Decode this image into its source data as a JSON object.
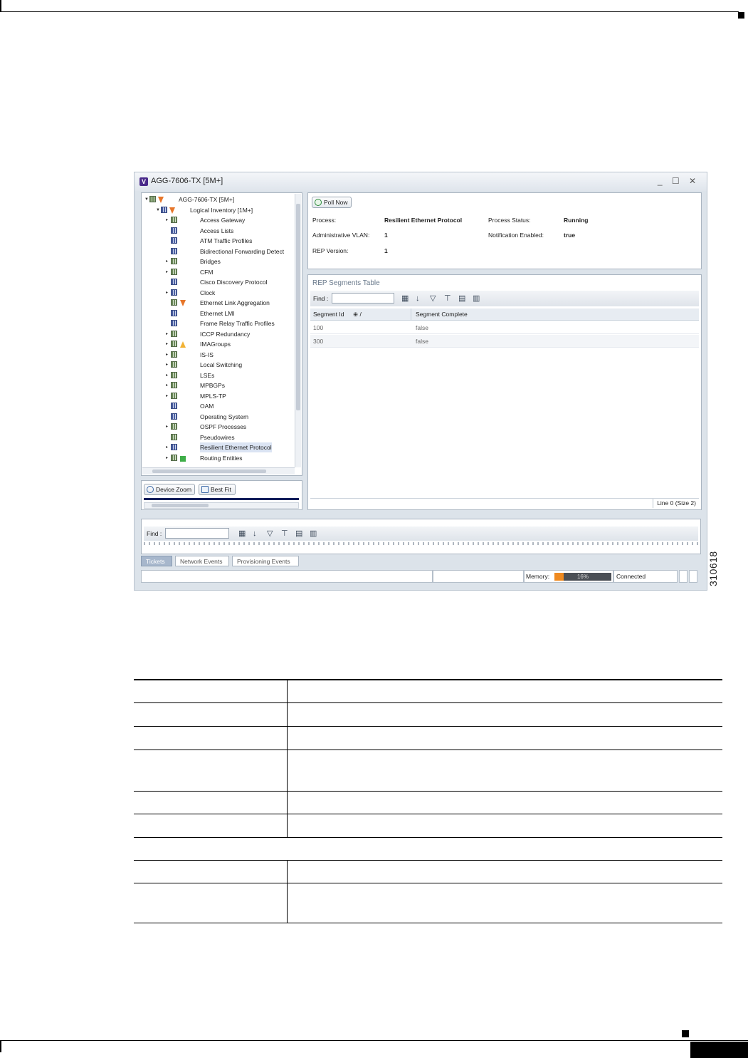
{
  "window": {
    "title": "AGG-7606-TX [5M+]",
    "logo": "V",
    "controls": "_ ☐ ✕"
  },
  "tree": {
    "root": "AGG-7606-TX [5M+]",
    "logical": "Logical Inventory [1M+]",
    "items": [
      {
        "label": "Access Gateway",
        "expand": true,
        "icon": "green"
      },
      {
        "label": "Access Lists",
        "expand": false,
        "icon": "blue"
      },
      {
        "label": "ATM Traffic Profiles",
        "expand": false,
        "icon": "blue"
      },
      {
        "label": "Bidirectional Forwarding Detect",
        "expand": false,
        "icon": "blue"
      },
      {
        "label": "Bridges",
        "expand": true,
        "icon": "green"
      },
      {
        "label": "CFM",
        "expand": true,
        "icon": "green"
      },
      {
        "label": "Cisco Discovery Protocol",
        "expand": false,
        "icon": "blue"
      },
      {
        "label": "Clock",
        "expand": true,
        "icon": "blue"
      },
      {
        "label": "Ethernet Link Aggregation",
        "expand": false,
        "icon": "green",
        "badge": "orange"
      },
      {
        "label": "Ethernet LMI",
        "expand": false,
        "icon": "blue"
      },
      {
        "label": "Frame Relay Traffic Profiles",
        "expand": false,
        "icon": "blue"
      },
      {
        "label": "ICCP Redundancy",
        "expand": true,
        "icon": "green"
      },
      {
        "label": "IMAGroups",
        "expand": true,
        "icon": "green",
        "badge": "warn"
      },
      {
        "label": "IS-IS",
        "expand": true,
        "icon": "green"
      },
      {
        "label": "Local Switching",
        "expand": true,
        "icon": "green"
      },
      {
        "label": "LSEs",
        "expand": true,
        "icon": "green"
      },
      {
        "label": "MPBGPs",
        "expand": true,
        "icon": "green"
      },
      {
        "label": "MPLS-TP",
        "expand": true,
        "icon": "green"
      },
      {
        "label": "OAM",
        "expand": false,
        "icon": "blue"
      },
      {
        "label": "Operating System",
        "expand": false,
        "icon": "blue"
      },
      {
        "label": "OSPF Processes",
        "expand": true,
        "icon": "green"
      },
      {
        "label": "Pseudowires",
        "expand": false,
        "icon": "green"
      },
      {
        "label": "Resilient Ethernet Protocol",
        "expand": true,
        "icon": "blue",
        "selected": true
      },
      {
        "label": "Routing Entities",
        "expand": true,
        "icon": "green",
        "badge": "green"
      }
    ]
  },
  "zoom": {
    "device_zoom": "Device Zoom",
    "best_fit": "Best Fit"
  },
  "props": {
    "poll_now": "Poll Now",
    "process_label": "Process:",
    "process_value": "Resilient Ethernet Protocol",
    "status_label": "Process Status:",
    "status_value": "Running",
    "vlan_label": "Administrative VLAN:",
    "vlan_value": "1",
    "notif_label": "Notification Enabled:",
    "notif_value": "true",
    "rep_version_label": "REP Version:",
    "rep_version_value": "1"
  },
  "rep_table": {
    "title": "REP Segments Table",
    "find_label": "Find :",
    "col_segment_id": "Segment Id",
    "col_sort": "⊕ /",
    "col_complete": "Segment Complete",
    "rows": [
      {
        "id": "100",
        "complete": "false"
      },
      {
        "id": "300",
        "complete": "false"
      }
    ],
    "status": "Line 0 (Size 2)"
  },
  "events": {
    "find_label": "Find :",
    "tabs": [
      "Tickets",
      "Network Events",
      "Provisioning Events"
    ]
  },
  "statusbar": {
    "memory_label": "Memory:",
    "memory_percent": "16%",
    "memory_fraction": 0.16,
    "connection": "Connected"
  },
  "figure_number": "310618",
  "colors": {
    "memory_fill": "#ef8a20",
    "selected_row": "#dbe4f3",
    "active_tab": "#a7b7cc"
  }
}
